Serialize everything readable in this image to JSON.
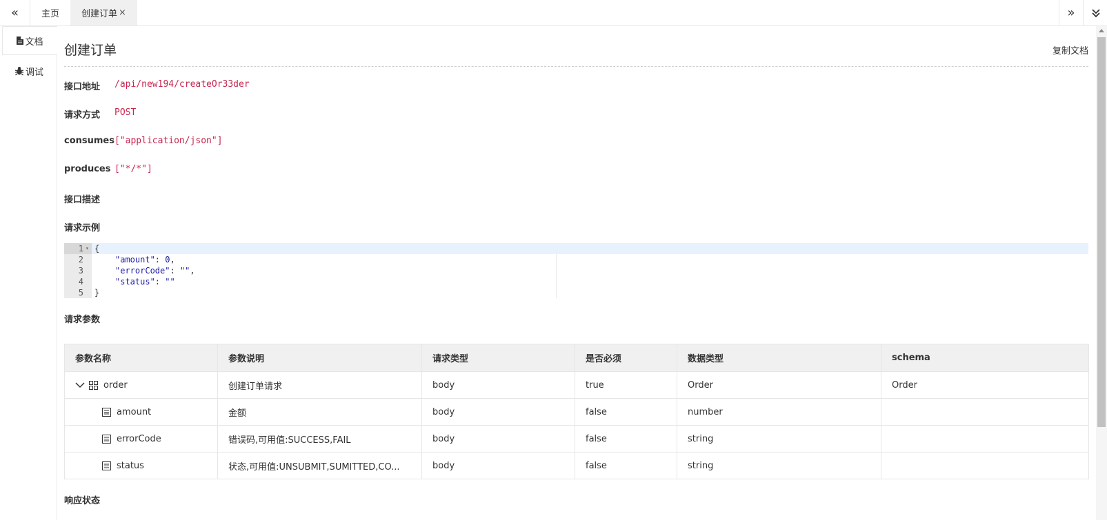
{
  "tabs": {
    "home": "主页",
    "active": "创建订单",
    "close_glyph": "×"
  },
  "nav": {
    "prev_glyph": "«",
    "next_glyph": "»"
  },
  "sidebar": {
    "doc_label": "文档",
    "debug_label": "调试"
  },
  "main": {
    "title": "创建订单",
    "copy_doc": "复制文档",
    "fields": {
      "address_label": "接口地址",
      "address_value": "/api/new194/createOr33der",
      "method_label": "请求方式",
      "method_value": "POST",
      "consumes_label": "consumes",
      "consumes_value": "[\"application/json\"]",
      "produces_label": "produces",
      "produces_value": "[\"*/*\"]",
      "desc_label": "接口描述",
      "example_label": "请求示例",
      "params_label": "请求参数",
      "response_label": "响应状态"
    }
  },
  "editor": {
    "line_numbers": [
      "1",
      "2",
      "3",
      "4",
      "5"
    ],
    "lines": [
      {
        "open": "{"
      },
      {
        "key": "\"amount\"",
        "sep": ": ",
        "val": "0",
        "tail": ","
      },
      {
        "key": "\"errorCode\"",
        "sep": ": ",
        "val": "\"\"",
        "tail": ","
      },
      {
        "key": "\"status\"",
        "sep": ": ",
        "val": "\"\"",
        "tail": ""
      },
      {
        "close": "}"
      }
    ]
  },
  "params_table": {
    "headers": [
      "参数名称",
      "参数说明",
      "请求类型",
      "是否必须",
      "数据类型",
      "schema"
    ],
    "rows": [
      {
        "name": "order",
        "desc": "创建订单请求",
        "in": "body",
        "required": "true",
        "type": "Order",
        "schema": "Order"
      },
      {
        "name": "amount",
        "desc": "金额",
        "in": "body",
        "required": "false",
        "type": "number",
        "schema": ""
      },
      {
        "name": "errorCode",
        "desc": "错误码,可用值:SUCCESS,FAIL",
        "in": "body",
        "required": "false",
        "type": "string",
        "schema": ""
      },
      {
        "name": "status",
        "desc": "状态,可用值:UNSUBMIT,SUMITTED,CO...",
        "in": "body",
        "required": "false",
        "type": "string",
        "schema": ""
      }
    ]
  }
}
